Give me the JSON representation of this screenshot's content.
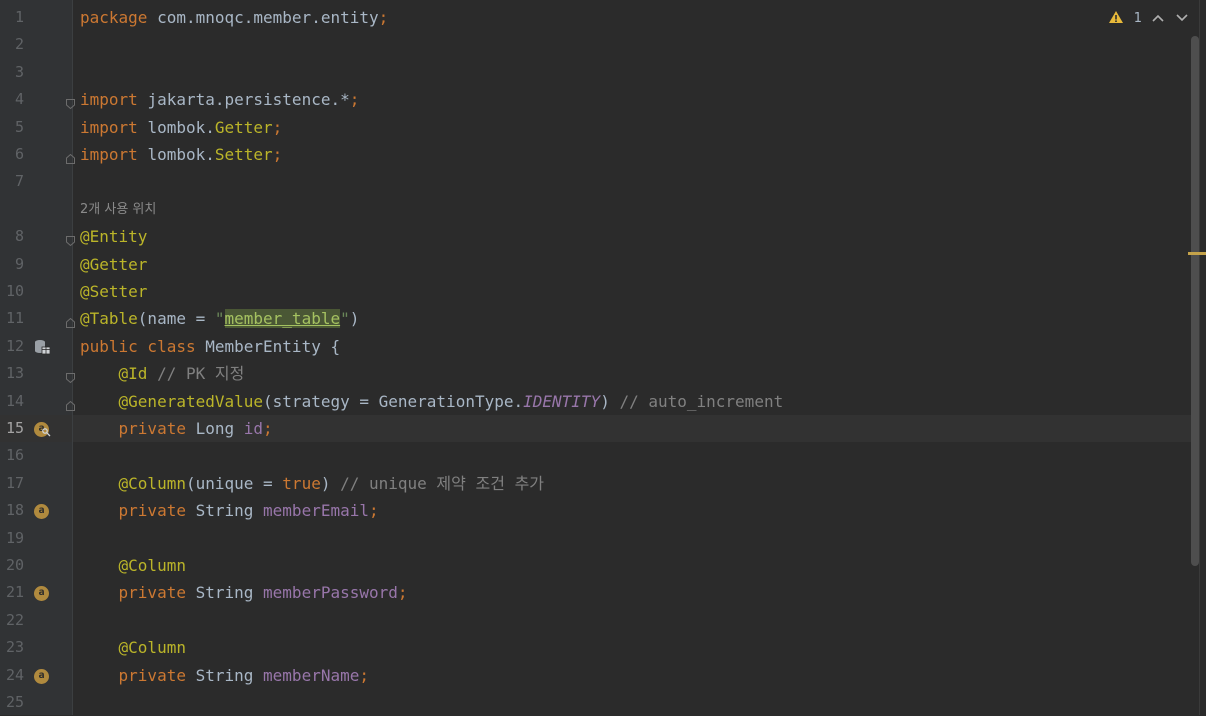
{
  "editor": {
    "inspection": {
      "warning_count": "1"
    },
    "hint_usages": "2개 사용 위치",
    "lines": [
      {
        "n": "1",
        "tokens": [
          [
            "kw",
            "package "
          ],
          [
            "tx",
            "com.mnoqc.member.entity"
          ],
          [
            "kw",
            ";"
          ]
        ]
      },
      {
        "n": "2",
        "tokens": []
      },
      {
        "n": "3",
        "tokens": []
      },
      {
        "n": "4",
        "tokens": [
          [
            "kw",
            "import "
          ],
          [
            "tx",
            "jakarta.persistence.*"
          ],
          [
            "kw",
            ";"
          ]
        ]
      },
      {
        "n": "5",
        "tokens": [
          [
            "kw",
            "import "
          ],
          [
            "tx",
            "lombok."
          ],
          [
            "an",
            "Getter"
          ],
          [
            "kw",
            ";"
          ]
        ]
      },
      {
        "n": "6",
        "tokens": [
          [
            "kw",
            "import "
          ],
          [
            "tx",
            "lombok."
          ],
          [
            "an",
            "Setter"
          ],
          [
            "kw",
            ";"
          ]
        ]
      },
      {
        "n": "7",
        "tokens": []
      },
      {
        "n": "8",
        "tokens": [
          [
            "an",
            "@Entity"
          ]
        ]
      },
      {
        "n": "9",
        "tokens": [
          [
            "an",
            "@Getter"
          ]
        ]
      },
      {
        "n": "10",
        "tokens": [
          [
            "an",
            "@Setter"
          ]
        ]
      },
      {
        "n": "11",
        "tokens": [
          [
            "an",
            "@Table"
          ],
          [
            "tx",
            "(name = "
          ],
          [
            "str",
            "\""
          ],
          [
            "strh",
            "member_table"
          ],
          [
            "str",
            "\""
          ],
          [
            "tx",
            ")"
          ]
        ]
      },
      {
        "n": "12",
        "tokens": [
          [
            "kw",
            "public class "
          ],
          [
            "tx",
            "MemberEntity {"
          ]
        ]
      },
      {
        "n": "13",
        "tokens": [
          [
            "tx",
            "    "
          ],
          [
            "an",
            "@Id "
          ],
          [
            "cm",
            "// PK 지정"
          ]
        ]
      },
      {
        "n": "14",
        "tokens": [
          [
            "tx",
            "    "
          ],
          [
            "an",
            "@GeneratedValue"
          ],
          [
            "tx",
            "(strategy = GenerationType."
          ],
          [
            "cst",
            "IDENTITY"
          ],
          [
            "tx",
            ") "
          ],
          [
            "cm",
            "// auto_increment"
          ]
        ]
      },
      {
        "n": "15",
        "tokens": [
          [
            "tx",
            "    "
          ],
          [
            "kw",
            "private "
          ],
          [
            "tx",
            "Long "
          ],
          [
            "fld",
            "id"
          ],
          [
            "kw",
            ";"
          ]
        ]
      },
      {
        "n": "16",
        "tokens": []
      },
      {
        "n": "17",
        "tokens": [
          [
            "tx",
            "    "
          ],
          [
            "an",
            "@Column"
          ],
          [
            "tx",
            "(unique = "
          ],
          [
            "kw",
            "true"
          ],
          [
            "tx",
            ") "
          ],
          [
            "cm",
            "// unique 제약 조건 추가"
          ]
        ]
      },
      {
        "n": "18",
        "tokens": [
          [
            "tx",
            "    "
          ],
          [
            "kw",
            "private "
          ],
          [
            "tx",
            "String "
          ],
          [
            "fld",
            "memberEmail"
          ],
          [
            "kw",
            ";"
          ]
        ]
      },
      {
        "n": "19",
        "tokens": []
      },
      {
        "n": "20",
        "tokens": [
          [
            "tx",
            "    "
          ],
          [
            "an",
            "@Column"
          ]
        ]
      },
      {
        "n": "21",
        "tokens": [
          [
            "tx",
            "    "
          ],
          [
            "kw",
            "private "
          ],
          [
            "tx",
            "String "
          ],
          [
            "fld",
            "memberPassword"
          ],
          [
            "kw",
            ";"
          ]
        ]
      },
      {
        "n": "22",
        "tokens": []
      },
      {
        "n": "23",
        "tokens": [
          [
            "tx",
            "    "
          ],
          [
            "an",
            "@Column"
          ]
        ]
      },
      {
        "n": "24",
        "tokens": [
          [
            "tx",
            "    "
          ],
          [
            "kw",
            "private "
          ],
          [
            "tx",
            "String "
          ],
          [
            "fld",
            "memberName"
          ],
          [
            "kw",
            ";"
          ]
        ]
      },
      {
        "n": "25",
        "tokens": []
      }
    ],
    "gutter_icons": {
      "12": "database-table-icon",
      "15": "primary-key-field-icon",
      "18": "field-annotation-icon",
      "21": "field-annotation-icon",
      "24": "field-annotation-icon"
    },
    "badge_letter": "a",
    "fold_markers": [
      "4",
      "6",
      "8",
      "11",
      "13",
      "14"
    ]
  }
}
